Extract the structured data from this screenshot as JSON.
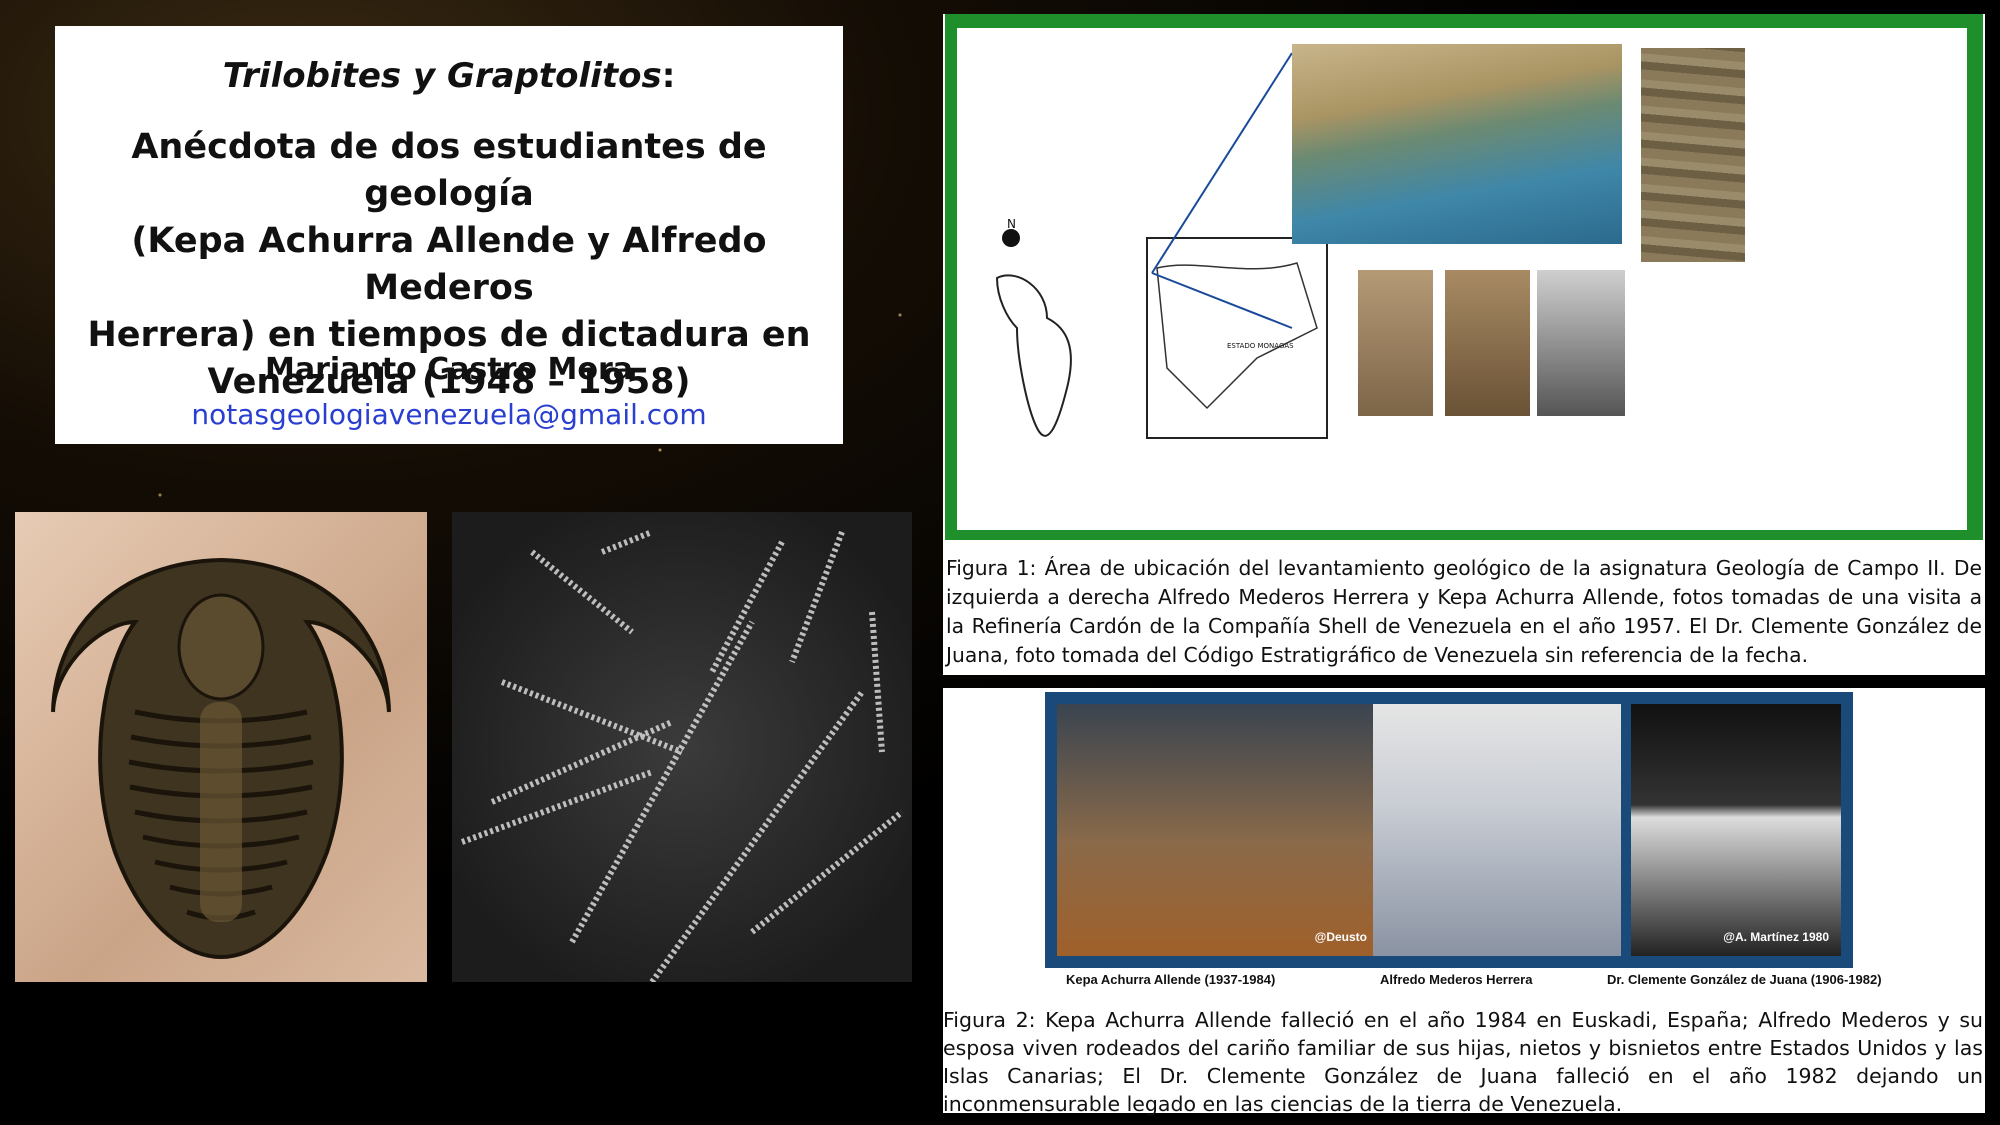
{
  "title_slide": {
    "italic_title": "Trilobites y Graptolitos",
    "title_colon": ":",
    "main_title_lines": [
      "Anécdota de dos estudiantes de geología",
      "(Kepa Achurra Allende y Alfredo Mederos",
      "Herrera) en tiempos de dictadura en",
      "Venezuela (1948 – 1958)"
    ],
    "author": "Marianto Castro Mora",
    "email": "notasgeologiavenezuela@gmail.com"
  },
  "figure1": {
    "caption": "Figura 1: Área de ubicación del levantamiento geológico de la asignatura Geología de Campo II. De izquierda a derecha Alfredo Mederos Herrera y Kepa Achurra Allende, fotos tomadas de una visita a la Refinería Cardón de la Compañía Shell de Venezuela en el año 1957. El Dr. Clemente González de Juana, foto tomada del Código Estratigráfico de Venezuela sin referencia de la fecha.",
    "map_labels": {
      "region": "ESTADO MONAGAS",
      "north": "N"
    }
  },
  "figure2": {
    "photo_labels": [
      "Kepa Achurra Allende (1937-1984)",
      "Alfredo Mederos Herrera",
      "Dr. Clemente González de Juana (1906-1982)"
    ],
    "credits": [
      "@Deusto",
      "@A. Martínez 1980"
    ],
    "caption": "Figura 2: Kepa Achurra Allende falleció en el año 1984 en Euskadi, España; Alfredo Mederos y su esposa viven rodeados del cariño familiar de sus hijas, nietos y bisnietos entre Estados Unidos y las Islas Canarias; El Dr. Clemente González de Juana falleció en el año 1982 dejando un inconmensurable legado en las ciencias de la tierra de Venezuela."
  }
}
